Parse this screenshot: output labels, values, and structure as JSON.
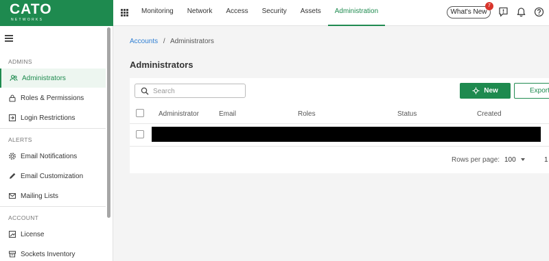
{
  "brand": {
    "name": "CATO",
    "tagline": "NETWORKS"
  },
  "nav": {
    "items": [
      "Monitoring",
      "Network",
      "Access",
      "Security",
      "Assets",
      "Administration"
    ],
    "active": "Administration"
  },
  "header": {
    "whats_new_label": "What's New",
    "whats_new_count": "7"
  },
  "sidebar": {
    "sections": [
      {
        "title": "ADMINS",
        "items": [
          {
            "label": "Administrators",
            "icon": "users-icon",
            "active": true
          },
          {
            "label": "Roles & Permissions",
            "icon": "lock-icon"
          },
          {
            "label": "Login Restrictions",
            "icon": "login-icon"
          }
        ]
      },
      {
        "title": "ALERTS",
        "items": [
          {
            "label": "Email Notifications",
            "icon": "gear-icon"
          },
          {
            "label": "Email Customization",
            "icon": "pencil-icon"
          },
          {
            "label": "Mailing Lists",
            "icon": "mail-icon"
          }
        ]
      },
      {
        "title": "ACCOUNT",
        "items": [
          {
            "label": "License",
            "icon": "license-icon"
          },
          {
            "label": "Sockets Inventory",
            "icon": "inventory-icon"
          }
        ]
      }
    ]
  },
  "breadcrumb": {
    "parent": "Accounts",
    "separator": "/",
    "current": "Administrators"
  },
  "page": {
    "title": "Administrators"
  },
  "toolbar": {
    "search_placeholder": "Search",
    "new_label": "New",
    "export_label": "Export"
  },
  "table": {
    "columns": [
      "Administrator",
      "Email",
      "Roles",
      "Status",
      "Created"
    ]
  },
  "pagination": {
    "rows_per_page_label": "Rows per page:",
    "rows_per_page": "100",
    "range_start": "1"
  },
  "colors": {
    "brand": "#1e8a4f",
    "link": "#2f7fd3",
    "badge": "#d9342b"
  }
}
